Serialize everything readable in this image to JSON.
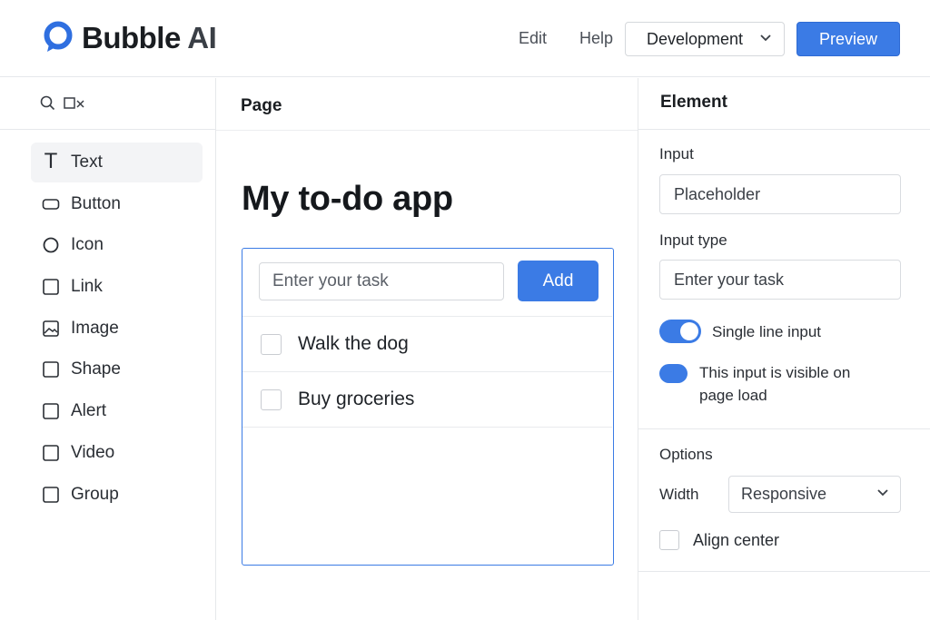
{
  "brand": {
    "name": "Bubble",
    "suffix": "AI",
    "accent": "#3b7be5"
  },
  "topnav": {
    "edit": "Edit",
    "help": "Help",
    "environment": "Development",
    "preview": "Preview"
  },
  "toolbar": {
    "icons": [
      "search-icon",
      "shape-select-icon"
    ]
  },
  "elements": [
    {
      "label": "Text",
      "icon": "text-icon",
      "active": true
    },
    {
      "label": "Button",
      "icon": "button-icon"
    },
    {
      "label": "Icon",
      "icon": "circle-icon"
    },
    {
      "label": "Link",
      "icon": "link-icon"
    },
    {
      "label": "Image",
      "icon": "image-icon"
    },
    {
      "label": "Shape",
      "icon": "shape-icon"
    },
    {
      "label": "Alert",
      "icon": "alert-icon"
    },
    {
      "label": "Video",
      "icon": "video-icon"
    },
    {
      "label": "Group",
      "icon": "group-icon"
    }
  ],
  "page": {
    "label": "Page",
    "title": "My to-do app",
    "task_placeholder": "Enter your task",
    "add_label": "Add",
    "tasks": [
      {
        "text": "Walk the dog",
        "checked": false
      },
      {
        "text": "Buy groceries",
        "checked": false
      }
    ]
  },
  "inspector": {
    "title": "Element",
    "input_label": "Input",
    "input_placeholder": "Placeholder",
    "input_type_label": "Input type",
    "input_type_value": "Enter your task",
    "single_line_label": "Single line input",
    "single_line_on": true,
    "visible_label_line1": "This input is visible on",
    "visible_label_line2": "page load",
    "visible_on": true,
    "options_label": "Options",
    "width_label": "Width",
    "width_value": "Responsive",
    "align_center_label": "Align center",
    "align_center_checked": false
  }
}
